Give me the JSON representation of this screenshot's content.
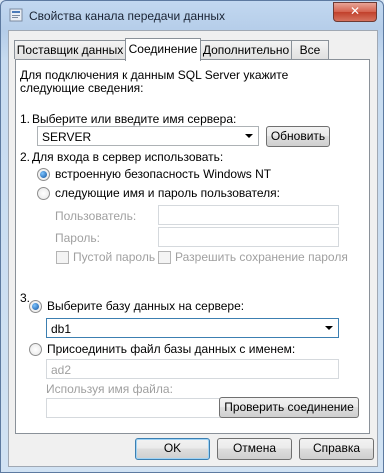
{
  "window": {
    "title": "Свойства канала передачи данных",
    "close_glyph": "✕"
  },
  "tabs": [
    {
      "label": "Поставщик данных"
    },
    {
      "label": "Соединение"
    },
    {
      "label": "Дополнительно"
    },
    {
      "label": "Все"
    }
  ],
  "intro_text": "Для подключения к данным SQL Server укажите следующие сведения:",
  "step1": {
    "number": "1.",
    "label": "Выберите или введите имя сервера:",
    "server_value": "SERVER",
    "refresh_label": "Обновить"
  },
  "step2": {
    "number": "2.",
    "label": "Для входа в сервер использовать:",
    "option_windows": "встроенную безопасность Windows NT",
    "option_sql": "следующие имя и пароль пользователя:",
    "user_label": "Пользователь:",
    "password_label": "Пароль:",
    "blank_password": "Пустой пароль",
    "allow_saving": "Разрешить сохранение пароля"
  },
  "step3": {
    "number": "3.",
    "option_select_db": "Выберите базу данных на сервере:",
    "db_value": "db1",
    "option_attach": "Присоединить файл базы данных с именем:",
    "attach_value": "ad2",
    "logical_name_label": "Используя имя файла:",
    "browse_label": "..."
  },
  "test_connection_label": "Проверить соединение",
  "footer": {
    "ok": "OK",
    "cancel": "Отмена",
    "help": "Справка"
  }
}
